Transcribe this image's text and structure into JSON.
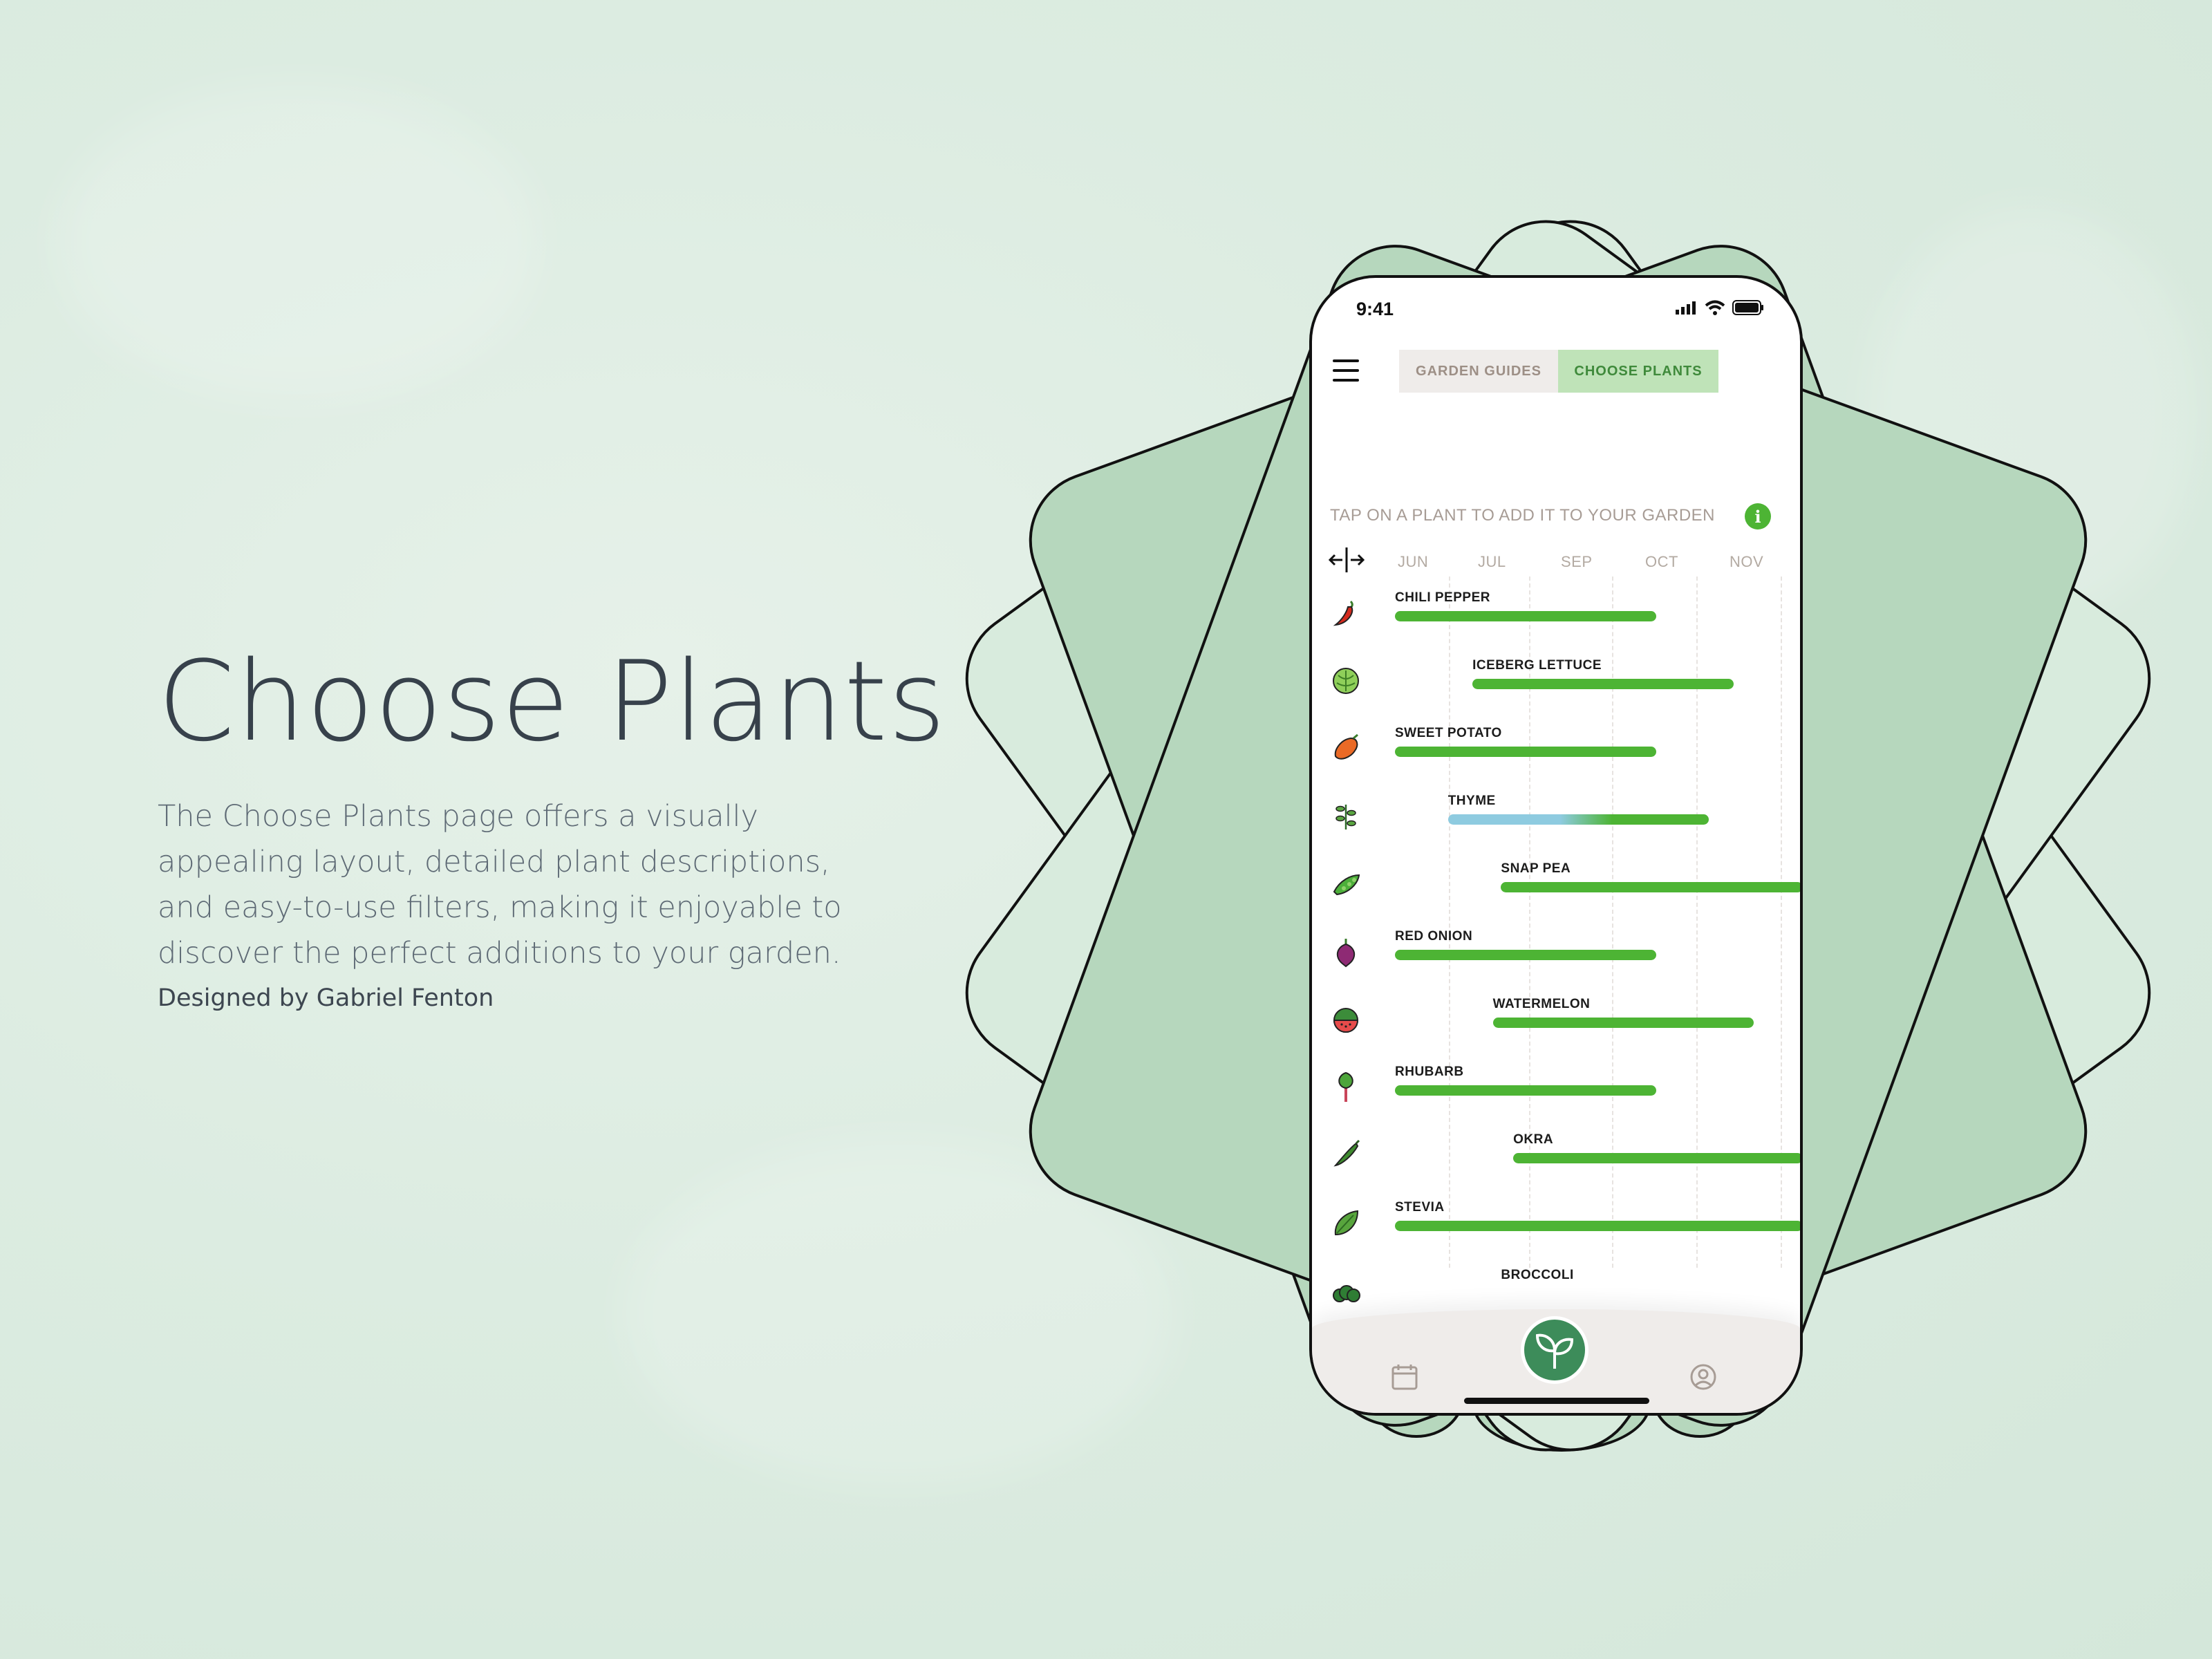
{
  "hero": {
    "title": "Choose Plants",
    "description": "The Choose Plants page offers a visually appealing layout, detailed plant descriptions, and easy-to-use filters, making it enjoyable to discover the perfect additions to your garden.",
    "credit": "Designed by Gabriel Fenton"
  },
  "phone": {
    "status": {
      "time": "9:41",
      "icons": [
        "signal-icon",
        "wifi-icon",
        "battery-icon"
      ]
    },
    "menu_icon": "hamburger-menu-icon",
    "tabs": [
      {
        "label": "GARDEN GUIDES",
        "active": false
      },
      {
        "label": "CHOOSE PLANTS",
        "active": true
      }
    ],
    "instruction": "TAP ON  A PLANT TO ADD IT TO YOUR GARDEN",
    "info_icon": "i",
    "months": [
      "JUN",
      "JUL",
      "SEP",
      "OCT",
      "NOV"
    ],
    "plants": [
      {
        "name": "CHILI PEPPER",
        "icon": "chili-pepper-icon",
        "start": 0.0,
        "end": 0.64
      },
      {
        "name": "ICEBERG LETTUCE",
        "icon": "lettuce-icon",
        "start": 0.19,
        "end": 0.83
      },
      {
        "name": "SWEET POTATO",
        "icon": "sweet-potato-icon",
        "start": 0.0,
        "end": 0.64
      },
      {
        "name": "THYME",
        "icon": "thyme-icon",
        "start": 0.13,
        "end": 0.77,
        "split": 0.33
      },
      {
        "name": "SNAP PEA",
        "icon": "snap-pea-icon",
        "start": 0.26,
        "end": 1.0
      },
      {
        "name": "RED ONION",
        "icon": "red-onion-icon",
        "start": 0.0,
        "end": 0.64
      },
      {
        "name": "WATERMELON",
        "icon": "watermelon-icon",
        "start": 0.24,
        "end": 0.88
      },
      {
        "name": "RHUBARB",
        "icon": "rhubarb-icon",
        "start": 0.0,
        "end": 0.64
      },
      {
        "name": "OKRA",
        "icon": "okra-icon",
        "start": 0.29,
        "end": 1.0
      },
      {
        "name": "STEVIA",
        "icon": "stevia-icon",
        "start": 0.0,
        "end": 1.0
      },
      {
        "name": "BROCCOLI",
        "icon": "broccoli-icon",
        "start": 0.26,
        "end": null
      }
    ],
    "bottom_nav": {
      "left_icon": "calendar-icon",
      "center_icon": "sprout-icon",
      "right_icon": "profile-icon"
    }
  },
  "colors": {
    "accent_green": "#4db434",
    "dark_green": "#3d8c5a",
    "thyme_blue": "#8ecbe0",
    "tab_active_bg": "#bfe3b8",
    "tab_inactive_bg": "#efecea"
  }
}
